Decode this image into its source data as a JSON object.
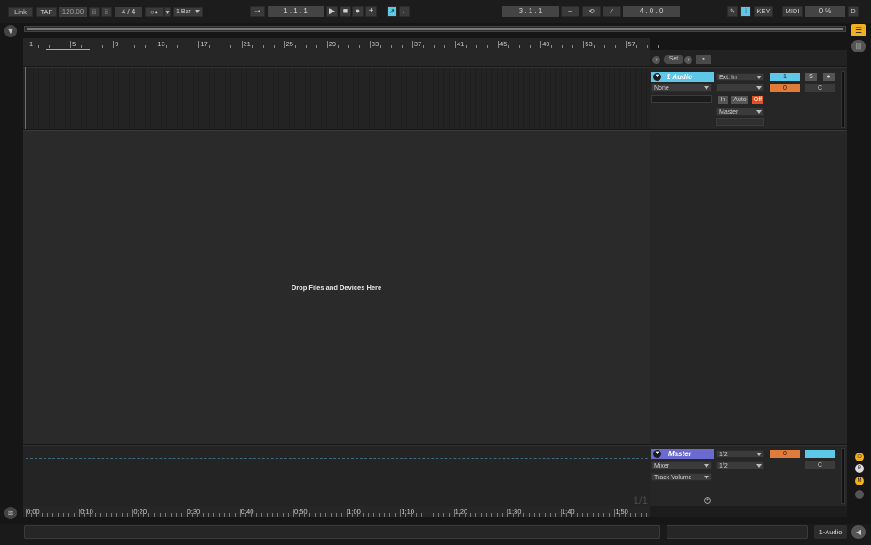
{
  "transport": {
    "link": "Link",
    "tap": "TAP",
    "tempo": "120.00",
    "time_sig": "4 / 4",
    "quantize": "1 Bar",
    "position": "1 . 1 . 1",
    "loop_start": "3 . 1 . 1",
    "loop_length": "4 . 0 . 0",
    "key": "KEY",
    "midi": "MIDI",
    "cpu": "0 %",
    "d": "D"
  },
  "ruler": {
    "bars": [
      "1",
      "5",
      "9",
      "13",
      "17",
      "21",
      "25",
      "29",
      "33",
      "37",
      "41",
      "45",
      "49",
      "53",
      "57"
    ]
  },
  "timeline": {
    "times": [
      "0:00",
      "0:10",
      "0:20",
      "0:30",
      "0:40",
      "0:50",
      "1:00",
      "1:10",
      "1:20",
      "1:30",
      "1:40",
      "1:50"
    ]
  },
  "set_controls": {
    "set": "Set"
  },
  "audio_track": {
    "name": "1 Audio",
    "clip_type": "None",
    "input": "Ext. In",
    "monitor_in": "In",
    "monitor_auto": "Auto",
    "monitor_off": "Off",
    "output": "Master",
    "number": "1",
    "solo": "S",
    "volume": "0",
    "pan": "C"
  },
  "arrangement": {
    "drop_hint": "Drop Files and Devices Here"
  },
  "master_track": {
    "name": "Master",
    "device": "Mixer",
    "param": "Track Volume",
    "in_1": "1/2",
    "in_2": "1/2",
    "volume": "0",
    "pan": "C",
    "zoom": "1/1"
  },
  "side_icons": {
    "io": "IO",
    "r": "R",
    "m": "M"
  },
  "status": {
    "selected_track": "1-Audio"
  },
  "colors": {
    "accent": "#5dc8e8",
    "volume": "#e07b3a",
    "master": "#6a6ad0",
    "off": "#e05020",
    "background": "#161616",
    "panel": "#2a2a2a"
  }
}
